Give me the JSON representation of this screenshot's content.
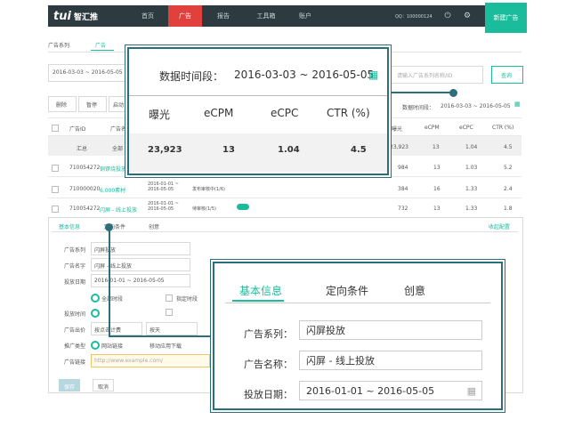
{
  "topbar": {
    "logo_latin": "tui",
    "logo_zh": "智汇推",
    "nav": [
      "首页",
      "广告",
      "报告",
      "工具箱",
      "账户"
    ],
    "qq": "QQ：100000124",
    "new_ad": "新建广告"
  },
  "background": {
    "tab1": "广告系列",
    "tab2": "广告",
    "date_range": "2016-03-03 ~ 2016-05-05",
    "search_placeholder": "请输入广告系列名称/ID",
    "search_btn": "查询",
    "toolbar": [
      "删除",
      "暂停",
      "启动"
    ],
    "period_label": "数据时间段：",
    "period_value": "2016-03-03 ~ 2016-05-05",
    "headers": [
      "广告ID",
      "广告名称",
      "曝光",
      "eCPM",
      "eCPC",
      "CTR (%)"
    ],
    "sum_label": "汇总",
    "sum_name": "全部",
    "sum_values": [
      "23,923",
      "13",
      "1.04",
      "4.5"
    ],
    "rows": [
      {
        "id": "710054272",
        "name": "铜锣烧投放广告",
        "dates": "",
        "status": "",
        "v": [
          "984",
          "13",
          "1.03",
          "5.2"
        ]
      },
      {
        "id": "710000020",
        "name": "6,000素材",
        "dates": "2016-01-01 ~ 2016-05-05",
        "status": "发布审核中(1/6)",
        "v": [
          "384",
          "16",
          "1.33",
          "2.4"
        ]
      },
      {
        "id": "710054272",
        "name": "闪屏 - 线上投放",
        "dates": "2016-01-01 ~ 2016-05-05",
        "status": "待审核(1/5)",
        "v": [
          "732",
          "13",
          "1.33",
          "1.8"
        ]
      }
    ],
    "sub_tabs": [
      "基本信息",
      "定向条件",
      "创意"
    ],
    "collapse": "收起配置",
    "form_labels": [
      "广告系列",
      "广告名字",
      "投放日期",
      "",
      "投放时间",
      "广告出价",
      "推广类型",
      "广告链接"
    ],
    "form_values": [
      "闪屏投放",
      "闪屏 - 线上投放",
      "2016-01-01 ~ 2016-05-05"
    ],
    "opt1": "全部时段",
    "opt2": "指定时段",
    "opt3": "按点击计费",
    "opt4": "按天",
    "opt5": "网站链接",
    "opt6": "移动应用下载",
    "link_placeholder": "http://www.example.com/",
    "save": "保存",
    "cancel": "取消"
  },
  "overlay_data": {
    "period_label": "数据时间段：",
    "period_value": "2016-03-03 ~ 2016-05-05",
    "headers": [
      "曝光",
      "eCPM",
      "eCPC",
      "CTR (%)"
    ],
    "values": [
      "23,923",
      "13",
      "1.04",
      "4.5"
    ]
  },
  "overlay_form": {
    "tabs": [
      "基本信息",
      "定向条件",
      "创意"
    ],
    "labels": [
      "广告系列：",
      "广告名称：",
      "投放日期："
    ],
    "values": [
      "闪屏投放",
      "闪屏 - 线上投放",
      "2016-01-01 ~ 2016-05-05"
    ]
  },
  "colors": {
    "accent": "#1abc9c",
    "nav_active": "#e0413c",
    "topbar": "#2d3a40",
    "callout": "#2c6e79"
  }
}
